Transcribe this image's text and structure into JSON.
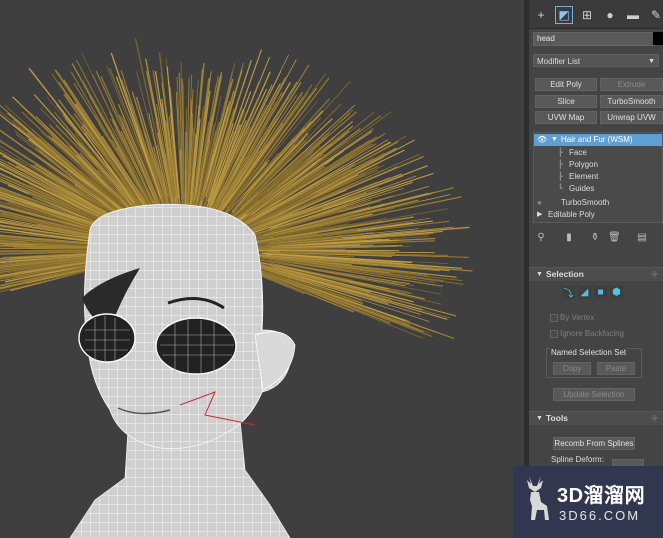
{
  "command_tabs": [
    {
      "name": "create-tab-icon",
      "glyph": "+"
    },
    {
      "name": "modify-tab-icon",
      "glyph": "◩"
    },
    {
      "name": "hierarchy-tab-icon",
      "glyph": "⊞"
    },
    {
      "name": "motion-tab-icon",
      "glyph": "●"
    },
    {
      "name": "display-tab-icon",
      "glyph": "▬"
    },
    {
      "name": "utilities-tab-icon",
      "glyph": "✎"
    }
  ],
  "object_name": "head",
  "object_color": "#000000",
  "modifier_list_label": "Modifier List",
  "modifier_buttons": [
    {
      "label": "Edit Poly",
      "enabled": true
    },
    {
      "label": "Extrude",
      "enabled": false
    },
    {
      "label": "Slice",
      "enabled": true
    },
    {
      "label": "TurboSmooth",
      "enabled": true
    },
    {
      "label": "UVW Map",
      "enabled": true
    },
    {
      "label": "Unwrap UVW",
      "enabled": true
    }
  ],
  "modifier_stack": [
    {
      "label": "Hair and Fur (WSM)",
      "level": 0,
      "selected": true,
      "expanded": true
    },
    {
      "label": "Face",
      "level": 1
    },
    {
      "label": "Polygon",
      "level": 1
    },
    {
      "label": "Element",
      "level": 1
    },
    {
      "label": "Guides",
      "level": 1
    },
    {
      "label": "TurboSmooth",
      "level": 0
    },
    {
      "label": "Editable Poly",
      "level": 0,
      "collapsed": true
    }
  ],
  "stack_tools": [
    "pin-stack-icon",
    "show-end-result-icon",
    "make-unique-icon",
    "remove-modifier-icon",
    "configure-sets-icon"
  ],
  "selection": {
    "title": "Selection",
    "sub_levels": [
      "guides-icon",
      "face-icon",
      "polygon-icon",
      "element-icon"
    ],
    "by_vertex": "By Vertex",
    "ignore_backfacing": "Ignore Backfacing",
    "named_set_title": "Named Selection Set",
    "copy": "Copy",
    "paste": "Paste",
    "update_selection": "Update Selection"
  },
  "tools": {
    "title": "Tools",
    "recomb": "Recomb From Splines",
    "spline_deform": "Spline Deform:"
  },
  "watermark": {
    "big": "3D溜溜网",
    "small": "3D66.COM"
  }
}
